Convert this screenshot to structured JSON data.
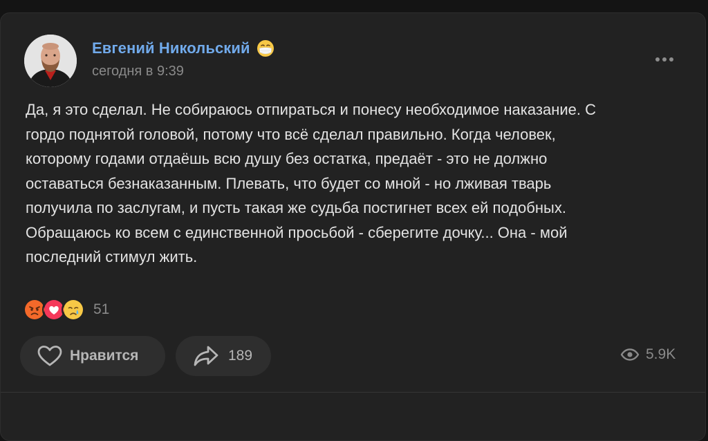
{
  "post": {
    "author": "Евгений Никольский",
    "author_status_icon": "medical-mask-emoji-icon",
    "time": "сегодня в 9:39",
    "text": "Да, я это сделал. Не собираюсь отпираться и понесу необходимое наказание. С\nгордо поднятой головой, потому что всё сделал правильно. Когда человек,\nкоторому годами отдаёшь всю душу без остатка, предаёт - это не должно\nоставаться безнаказанным. Плевать, что будет со мной - но лживая тварь\nполучила по заслугам, и пусть такая же судьба постигнет всех ей подобных.\nОбращаюсь ко всем с единственной просьбой - сберегите дочку... Она - мой\nпоследний стимул жить.",
    "reactions": {
      "icons": [
        "angry-face-icon",
        "heart-icon",
        "crying-face-icon"
      ],
      "count": "51"
    },
    "actions": {
      "like_label": "Нравится",
      "share_count": "189"
    },
    "views": "5.9K"
  },
  "colors": {
    "background": "#141414",
    "card": "#222222",
    "author_link": "#71aaeb",
    "text": "#e3e3e3",
    "secondary": "#8a8a8a",
    "button": "#2e2e2e"
  }
}
